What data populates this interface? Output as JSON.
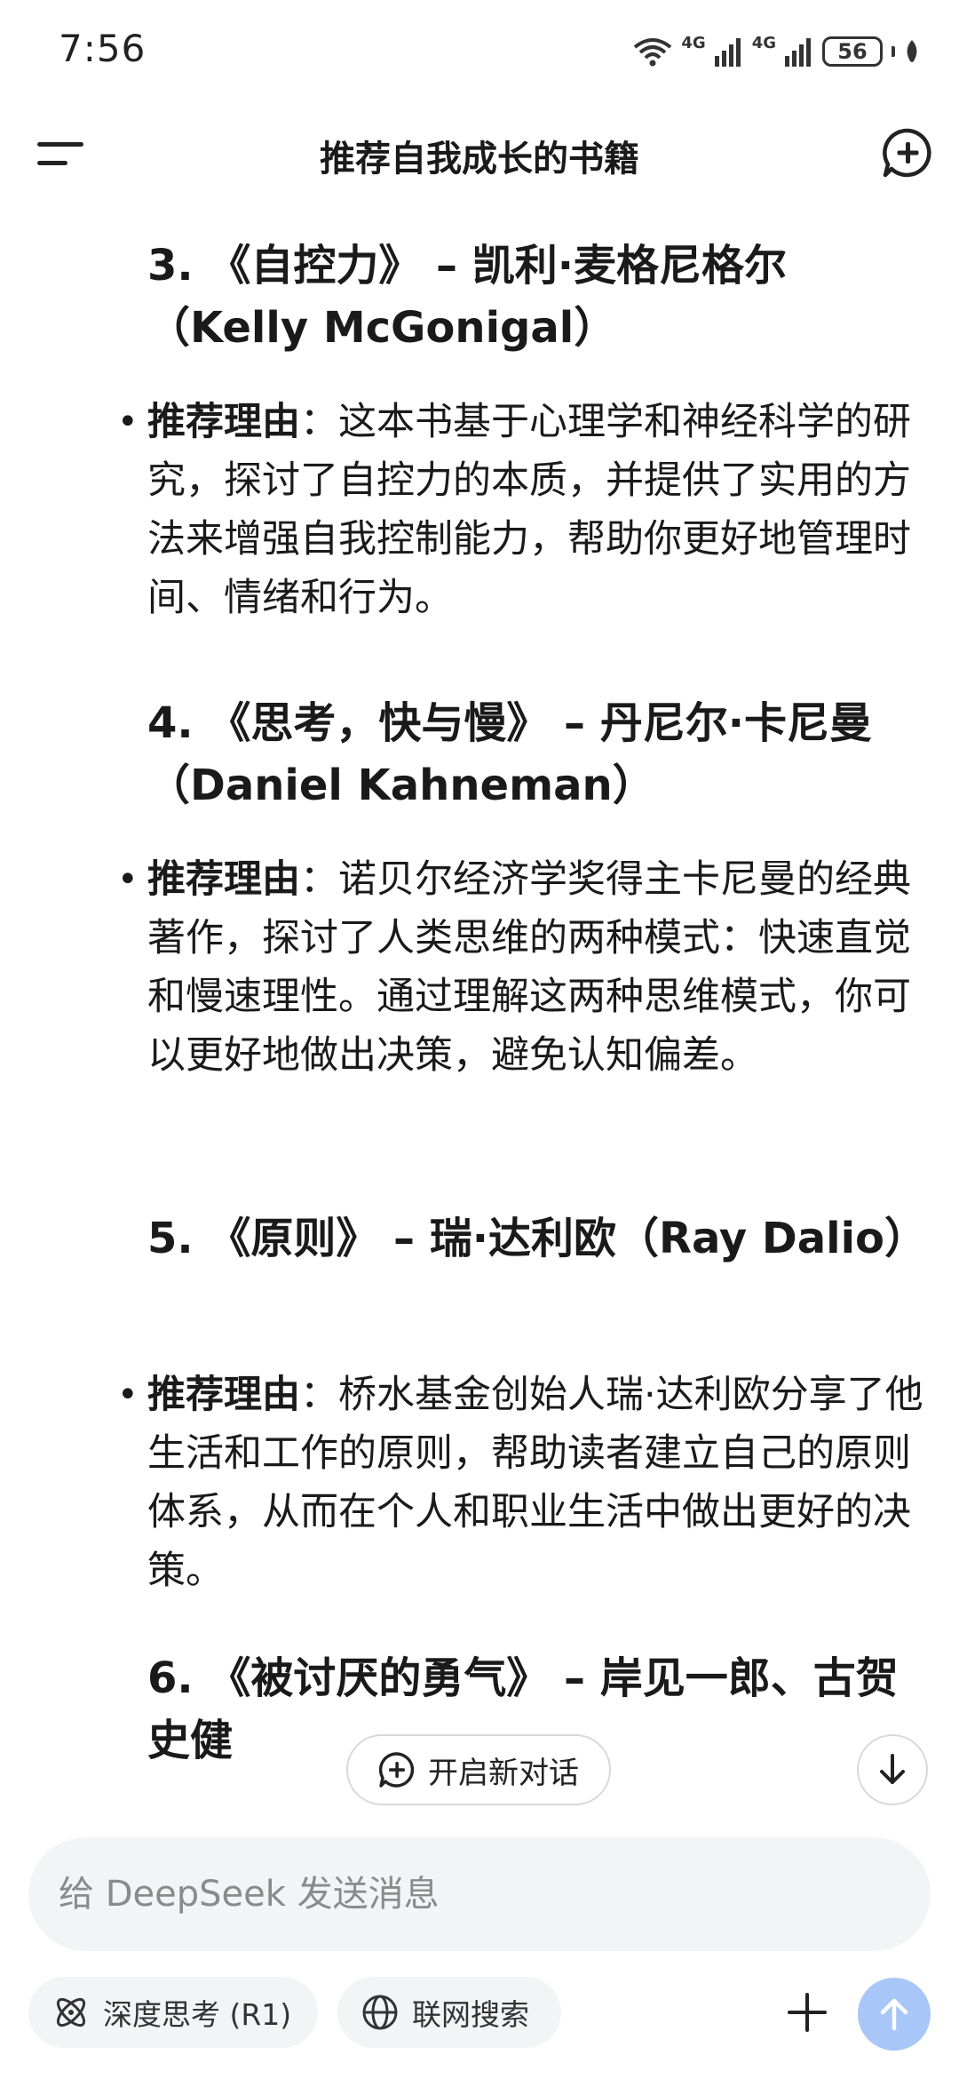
{
  "status_bar": {
    "time": "7:56",
    "network_1": "4G",
    "network_2": "4G",
    "battery": "56"
  },
  "header": {
    "title": "推荐自我成长的书籍"
  },
  "books": [
    {
      "title": "3. 《自控力》 – 凯利·麦格尼格尔（Kelly McGonigal）",
      "label": "推荐理由",
      "reason": "：这本书基于心理学和神经科学的研究，探讨了自控力的本质，并提供了实用的方法来增强自我控制能力，帮助你更好地管理时间、情绪和行为。"
    },
    {
      "title": "4. 《思考，快与慢》 – 丹尼尔·卡尼曼（Daniel Kahneman）",
      "label": "推荐理由",
      "reason": "：诺贝尔经济学奖得主卡尼曼的经典著作，探讨了人类思维的两种模式：快速直觉和慢速理性。通过理解这两种思维模式，你可以更好地做出决策，避免认知偏差。"
    },
    {
      "title": "5. 《原则》 – 瑞·达利欧（Ray Dalio）",
      "label": "推荐理由",
      "reason": "：桥水基金创始人瑞·达利欧分享了他生活和工作的原则，帮助读者建立自己的原则体系，从而在个人和职业生活中做出更好的决策。"
    },
    {
      "title": "6. 《被讨厌的勇气》 – 岸见一郎、古贺史健"
    }
  ],
  "floating": {
    "new_chat": "开启新对话"
  },
  "composer": {
    "placeholder": "给 DeepSeek 发送消息",
    "deep_think": "深度思考 (R1)",
    "web_search": "联网搜索"
  },
  "colors": {
    "send_button": "#a8c6f7",
    "input_bg": "#f3f4f6"
  }
}
